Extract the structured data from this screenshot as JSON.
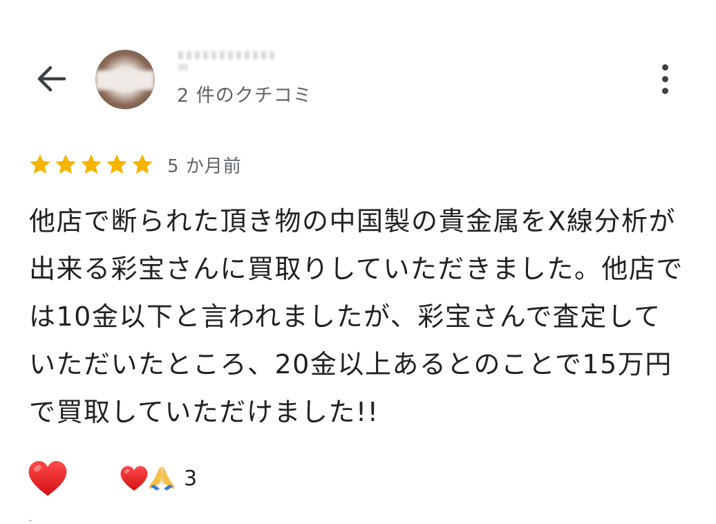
{
  "header": {
    "review_count": "2 件のクチコミ",
    "back_icon": "arrow-left-icon",
    "more_icon": "more-vert-icon"
  },
  "review": {
    "stars": 5,
    "max_stars": 5,
    "star_color": "#f5b400",
    "time_ago": "5 か月前",
    "text": "他店で断られた頂き物の中国製の貴金属をX線分析が出来る彩宝さんに買取りしていただきました。他店では10金以下と言われましたが、彩宝さんで査定していただいたところ、20金以上あるとのことで15万円で買取していただけました!!"
  },
  "reactions": {
    "heart_icon": "red-heart-icon",
    "summary_icons": [
      "red-heart-icon",
      "folded-hands-icon"
    ],
    "count": "3"
  }
}
